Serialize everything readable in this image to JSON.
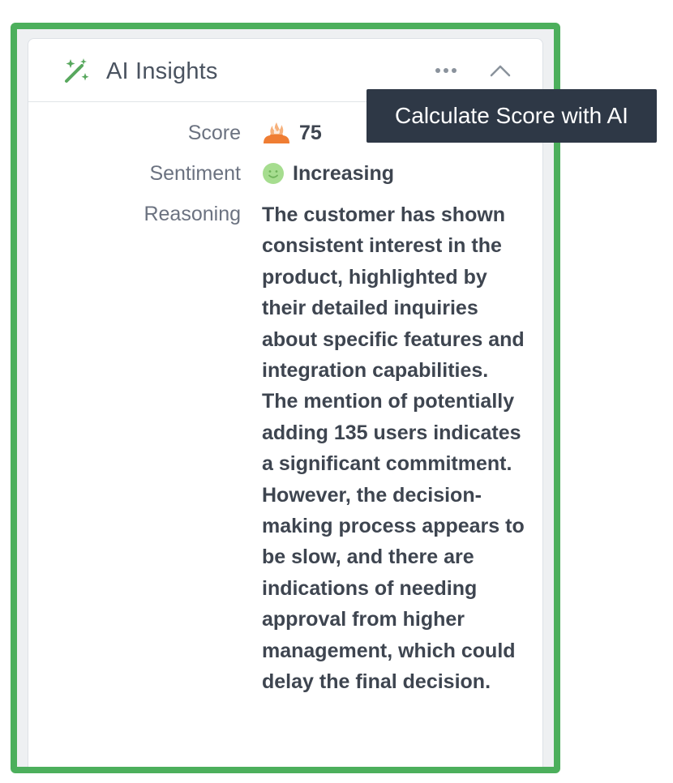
{
  "panel": {
    "title": "AI Insights",
    "colors": {
      "frame": "#4caf5c",
      "accent": "#58a85e",
      "tooltip_bg": "#2e3846",
      "score_icon": "#ef7d33",
      "sentiment_icon": "#a6dd8f"
    },
    "icons": {
      "title": "magic-wand-icon",
      "more": "more-horizontal-icon",
      "collapse": "chevron-up-icon",
      "score": "flame-score-icon",
      "sentiment": "smiley-face-icon"
    }
  },
  "fields": {
    "score_label": "Score",
    "score_value": "75",
    "sentiment_label": "Sentiment",
    "sentiment_value": "Increasing",
    "reasoning_label": "Reasoning",
    "reasoning_value": "The customer has shown consistent interest in the product, highlighted by their detailed inquiries about specific features and integration capabilities. The mention of potentially adding 135 users indicates a significant commitment. However, the decision-making process appears to be slow, and there are indications of needing approval from higher management, which could delay the final decision."
  },
  "tooltip": {
    "text": "Calculate Score with AI"
  }
}
